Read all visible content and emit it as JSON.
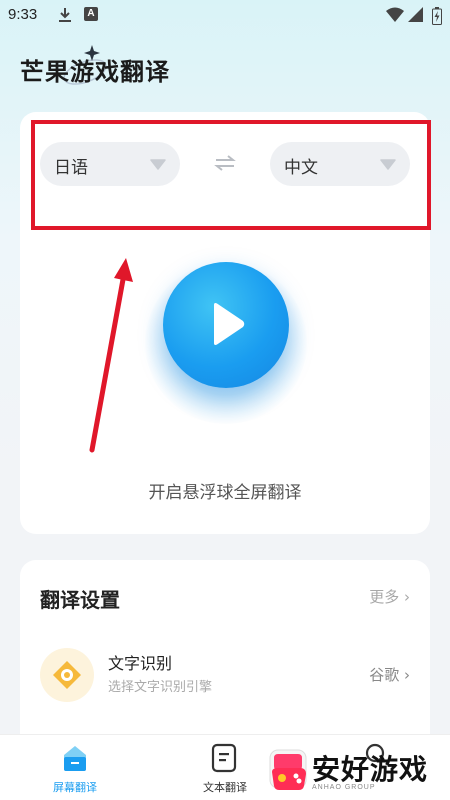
{
  "status_bar": {
    "time": "9:33"
  },
  "app": {
    "title": "芒果游戏翻译"
  },
  "translator": {
    "source_lang": "日语",
    "target_lang": "中文",
    "start_label": "开启悬浮球全屏翻译"
  },
  "settings": {
    "title": "翻译设置",
    "more_label": "更多 ›",
    "ocr": {
      "title": "文字识别",
      "subtitle": "选择文字识别引擎",
      "value": "谷歌 ›"
    }
  },
  "bottom_nav": {
    "items": [
      {
        "label": "屏幕翻译",
        "active": true
      },
      {
        "label": "文本翻译",
        "active": false
      }
    ]
  },
  "watermark": {
    "text": "安好游戏",
    "small": "ANHAO GROUP"
  },
  "colors": {
    "accent": "#1a9df0",
    "highlight": "#e0172a"
  }
}
